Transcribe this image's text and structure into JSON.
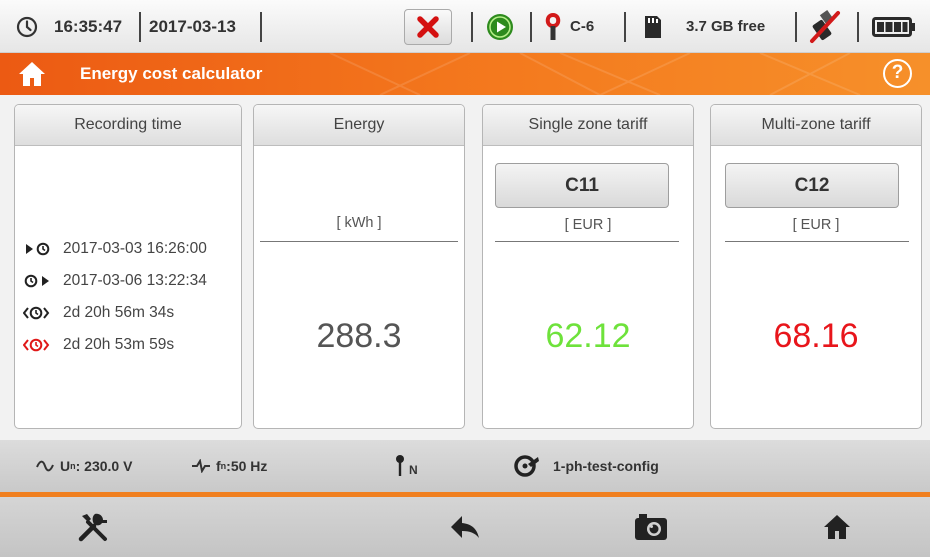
{
  "status": {
    "time": "16:35:47",
    "date": "2017-03-13",
    "clamp": "C-6",
    "storage": "3.7 GB free",
    "icons": [
      "clock-icon",
      "error-x-icon",
      "record-play-icon",
      "clamp-icon",
      "sd-card-icon",
      "usb-disconnected-icon",
      "battery-icon"
    ]
  },
  "header": {
    "title": "Energy cost calculator",
    "help": "?"
  },
  "recording": {
    "heading": "Recording time",
    "start": "2017-03-03 16:26:00",
    "stop": "2017-03-06 13:22:34",
    "duration": "2d 20h 56m 34s",
    "active_duration": "2d 20h 53m 59s"
  },
  "energy": {
    "heading": "Energy",
    "unit": "[ kWh ]",
    "value": "288.3"
  },
  "single_zone": {
    "heading": "Single zone tariff",
    "tariff": "C11",
    "unit": "[ EUR ]",
    "value": "62.12",
    "color": "#6ee23b"
  },
  "multi_zone": {
    "heading": "Multi-zone tariff",
    "tariff": "C12",
    "unit": "[ EUR ]",
    "value": "68.16",
    "color": "#e8151b"
  },
  "info": {
    "voltage_label": "U",
    "voltage_sub": "n",
    "voltage_value": ": 230.0 V",
    "freq_label": "f",
    "freq_sub": "n",
    "freq_value": ":50 Hz",
    "network": "N",
    "config": "1-ph-test-config"
  },
  "colors": {
    "accent": "#f07f1f",
    "panel_border": "#b5b5b5"
  }
}
